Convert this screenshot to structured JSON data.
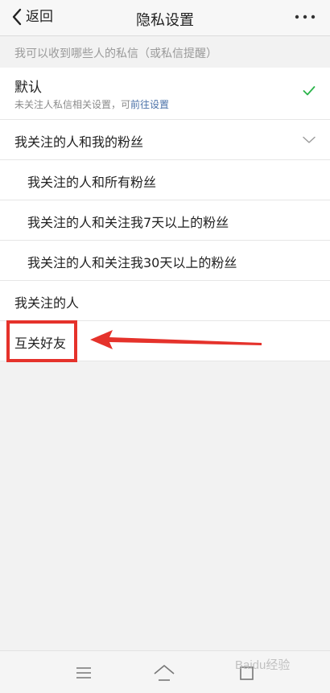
{
  "nav": {
    "back_label": "返回",
    "title": "隐私设置"
  },
  "section": {
    "header": "我可以收到哪些人的私信（或私信提醒）"
  },
  "options": {
    "default": {
      "label": "默认",
      "sub_prefix": "未关注人私信相关设置，可",
      "sub_link": "前往设置",
      "selected": true
    },
    "follow_and_fans": {
      "label": "我关注的人和我的粉丝"
    },
    "follow_and_all_fans": {
      "label": "我关注的人和所有粉丝"
    },
    "follow_and_fans_7days": {
      "label": "我关注的人和关注我7天以上的粉丝"
    },
    "follow_and_fans_30days": {
      "label": "我关注的人和关注我30天以上的粉丝"
    },
    "following_only": {
      "label": "我关注的人"
    },
    "mutual_friends": {
      "label": "互关好友"
    }
  },
  "watermark": {
    "text": "Baidu经验"
  },
  "colors": {
    "check": "#2bb44a",
    "link": "#4b72a8",
    "annotation": "#e5322b"
  },
  "icons": {
    "back": "chevron-left-icon",
    "more": "more-dots-icon",
    "selected": "check-icon",
    "expand": "chevron-down-icon",
    "menu": "menu-icon",
    "home": "home-icon",
    "return": "back-icon"
  }
}
